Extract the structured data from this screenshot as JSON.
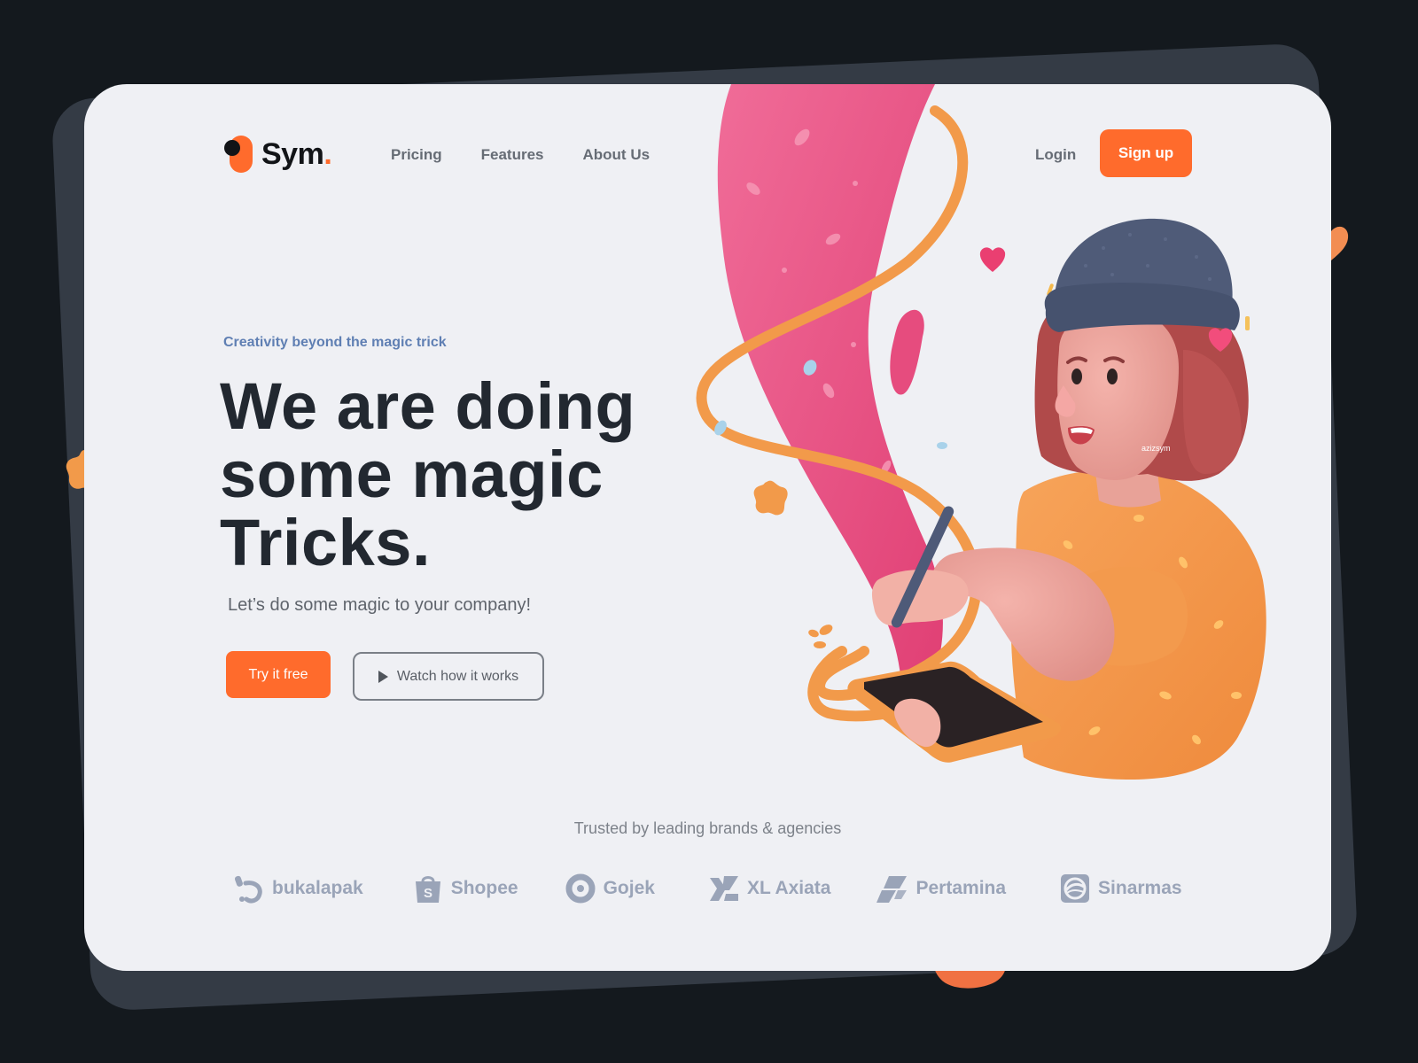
{
  "brand": {
    "name": "Sym",
    "dot": "."
  },
  "nav": {
    "items": [
      "Pricing",
      "Features",
      "About Us"
    ]
  },
  "auth": {
    "login": "Login",
    "signup": "Sign up"
  },
  "hero": {
    "eyebrow": "Creativity beyond the magic trick",
    "headline": [
      "We are doing",
      "some magic",
      "Tricks."
    ],
    "subtitle": "Let’s do some magic to your company!",
    "primary_cta": "Try it free",
    "secondary_cta": "Watch how it works"
  },
  "illustration": {
    "signature": "azizsym"
  },
  "trusted": {
    "label": "Trusted by leading brands & agencies",
    "brands": [
      {
        "name": "bukalapak",
        "icon": "bukalapak-icon"
      },
      {
        "name": "Shopee",
        "icon": "shopee-bag-icon"
      },
      {
        "name": "Gojek",
        "icon": "gojek-icon"
      },
      {
        "name": "XL Axiata",
        "icon": "xl-axiata-icon"
      },
      {
        "name": "Pertamina",
        "icon": "pertamina-icon"
      },
      {
        "name": "Sinarmas",
        "icon": "sinarmas-icon"
      }
    ]
  },
  "colors": {
    "accent": "#ff6b2c",
    "background": "#14191e",
    "card": "#eff0f4",
    "headline": "#222830",
    "eyebrow": "#5f7fb3",
    "brand_logos": "#9aa4b8"
  }
}
